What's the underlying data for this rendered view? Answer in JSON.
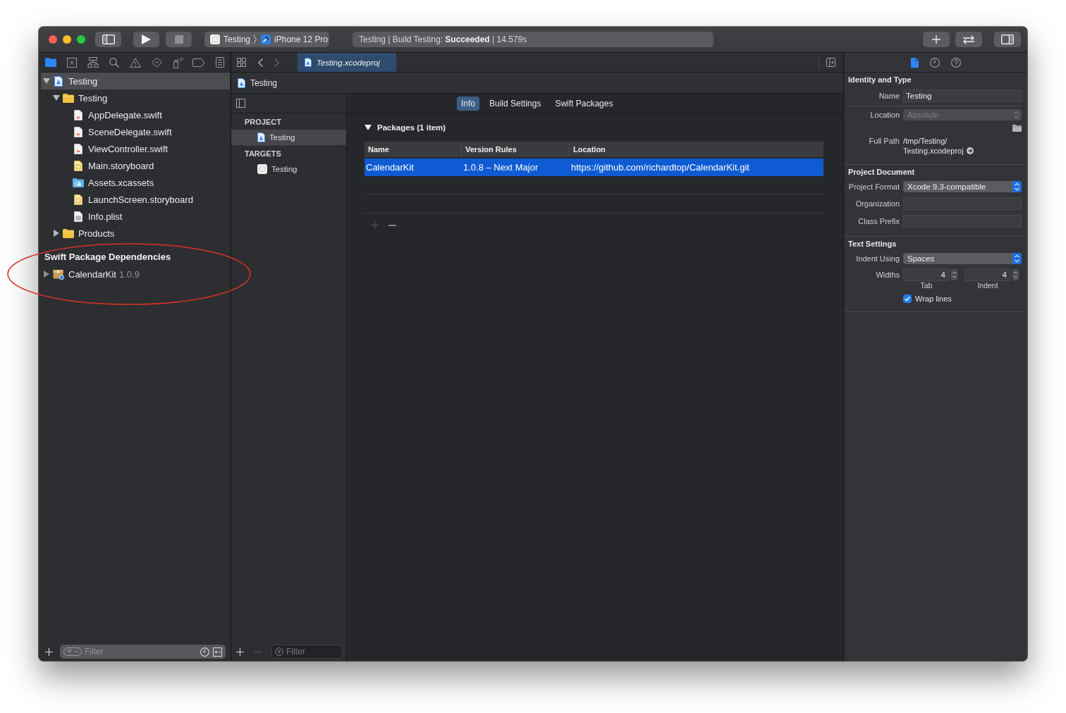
{
  "toolbar": {
    "scheme": "Testing",
    "destination": "iPhone 12 Pro",
    "activity": "Testing | Build Testing: **Succeeded** | 14.579s"
  },
  "navigator": {
    "tabs": [
      {
        "kind": "folder",
        "selected": true
      },
      {
        "kind": "source_control",
        "selected": false
      },
      {
        "kind": "symbols",
        "selected": false
      },
      {
        "kind": "find",
        "selected": false
      },
      {
        "kind": "issues",
        "selected": false
      },
      {
        "kind": "tests",
        "selected": false
      },
      {
        "kind": "debug",
        "selected": false
      },
      {
        "kind": "breakpoints",
        "selected": false
      },
      {
        "kind": "reports",
        "selected": false
      }
    ],
    "tree": [
      {
        "name": "Testing",
        "kind": "project",
        "expanded": true,
        "selected": true,
        "children": [
          {
            "name": "Testing",
            "kind": "folder",
            "expanded": true,
            "selected": false,
            "children": [
              {
                "name": "AppDelegate.swift",
                "kind": "swift",
                "selected": false
              },
              {
                "name": "SceneDelegate.swift",
                "kind": "swift",
                "selected": false
              },
              {
                "name": "ViewController.swift",
                "kind": "swift",
                "selected": false
              },
              {
                "name": "Main.storyboard",
                "kind": "storyboard",
                "selected": false
              },
              {
                "name": "Assets.xcassets",
                "kind": "assets",
                "selected": false
              },
              {
                "name": "LaunchScreen.storyboard",
                "kind": "storyboard",
                "selected": false
              },
              {
                "name": "Info.plist",
                "kind": "plist",
                "selected": false
              }
            ]
          },
          {
            "name": "Products",
            "kind": "folder",
            "expanded": false,
            "selected": false
          }
        ]
      }
    ],
    "dependencies": {
      "title": "Swift Package Dependencies",
      "items": [
        {
          "name": "CalendarKit",
          "version": "1.0.9",
          "expanded": false,
          "selected": false
        }
      ]
    },
    "buttons": [
      {
        "kind": "add",
        "disabled": false
      }
    ],
    "filter": {
      "placeholder": "Filter"
    }
  },
  "editor": {
    "tabs": [
      {
        "title": "Testing.xcodeproj",
        "selected": true
      }
    ],
    "jump_bar": [
      "Testing"
    ],
    "project_list": {
      "sections": [
        {
          "title": "PROJECT",
          "items": [
            {
              "name": "Testing",
              "kind": "project",
              "selected": true
            }
          ]
        },
        {
          "title": "TARGETS",
          "items": [
            {
              "name": "Testing",
              "kind": "app",
              "selected": false
            }
          ]
        }
      ],
      "buttons": [
        {
          "kind": "add",
          "disabled": false
        },
        {
          "kind": "remove",
          "disabled": true
        }
      ],
      "filter": {
        "placeholder": "Filter"
      }
    },
    "segments": [
      {
        "label": "Info",
        "selected": true
      },
      {
        "label": "Build Settings",
        "selected": false
      },
      {
        "label": "Swift Packages",
        "selected": false
      }
    ],
    "packages": {
      "title": "Packages (1 item)",
      "expanded": true,
      "columns": [
        "Name",
        "Version Rules",
        "Location"
      ],
      "rows": [
        {
          "cells": [
            "CalendarKit",
            "1.0.8 – Next Major",
            "https://github.com/richardtop/CalendarKit.git"
          ],
          "selected": true
        }
      ],
      "buttons": [
        {
          "kind": "add",
          "disabled": true
        },
        {
          "kind": "remove",
          "disabled": false
        }
      ]
    }
  },
  "inspector": {
    "tabs": [
      {
        "kind": "file",
        "selected": true
      },
      {
        "kind": "history",
        "selected": false
      },
      {
        "kind": "help",
        "selected": false
      }
    ],
    "sections": [
      {
        "title": "Identity and Type",
        "fields": [
          {
            "kind": "text",
            "label": "Name",
            "value": "Testing"
          },
          {
            "kind": "popup",
            "label": "Location",
            "value": "Absolute",
            "disabled": true
          },
          {
            "kind": "browse"
          },
          {
            "kind": "path",
            "label": "Full Path",
            "lines": [
              "/tmp/Testing/",
              "Testing.xcodeproj"
            ]
          }
        ]
      },
      {
        "title": "Project Document",
        "fields": [
          {
            "kind": "popup",
            "label": "Project Format",
            "value": "Xcode 9.3-compatible",
            "disabled": false
          },
          {
            "kind": "text",
            "label": "Organization"
          },
          {
            "kind": "text",
            "label": "Class Prefix"
          }
        ]
      },
      {
        "title": "Text Settings",
        "fields": [
          {
            "kind": "popup",
            "label": "Indent Using",
            "value": "Spaces",
            "disabled": false
          },
          {
            "kind": "steppers",
            "label": "Widths",
            "steppers": [
              {
                "value": "4",
                "caption": "Tab"
              },
              {
                "value": "4",
                "caption": "Indent"
              }
            ]
          },
          {
            "kind": "checkbox",
            "label": "Wrap lines",
            "checked": true
          }
        ]
      }
    ]
  }
}
